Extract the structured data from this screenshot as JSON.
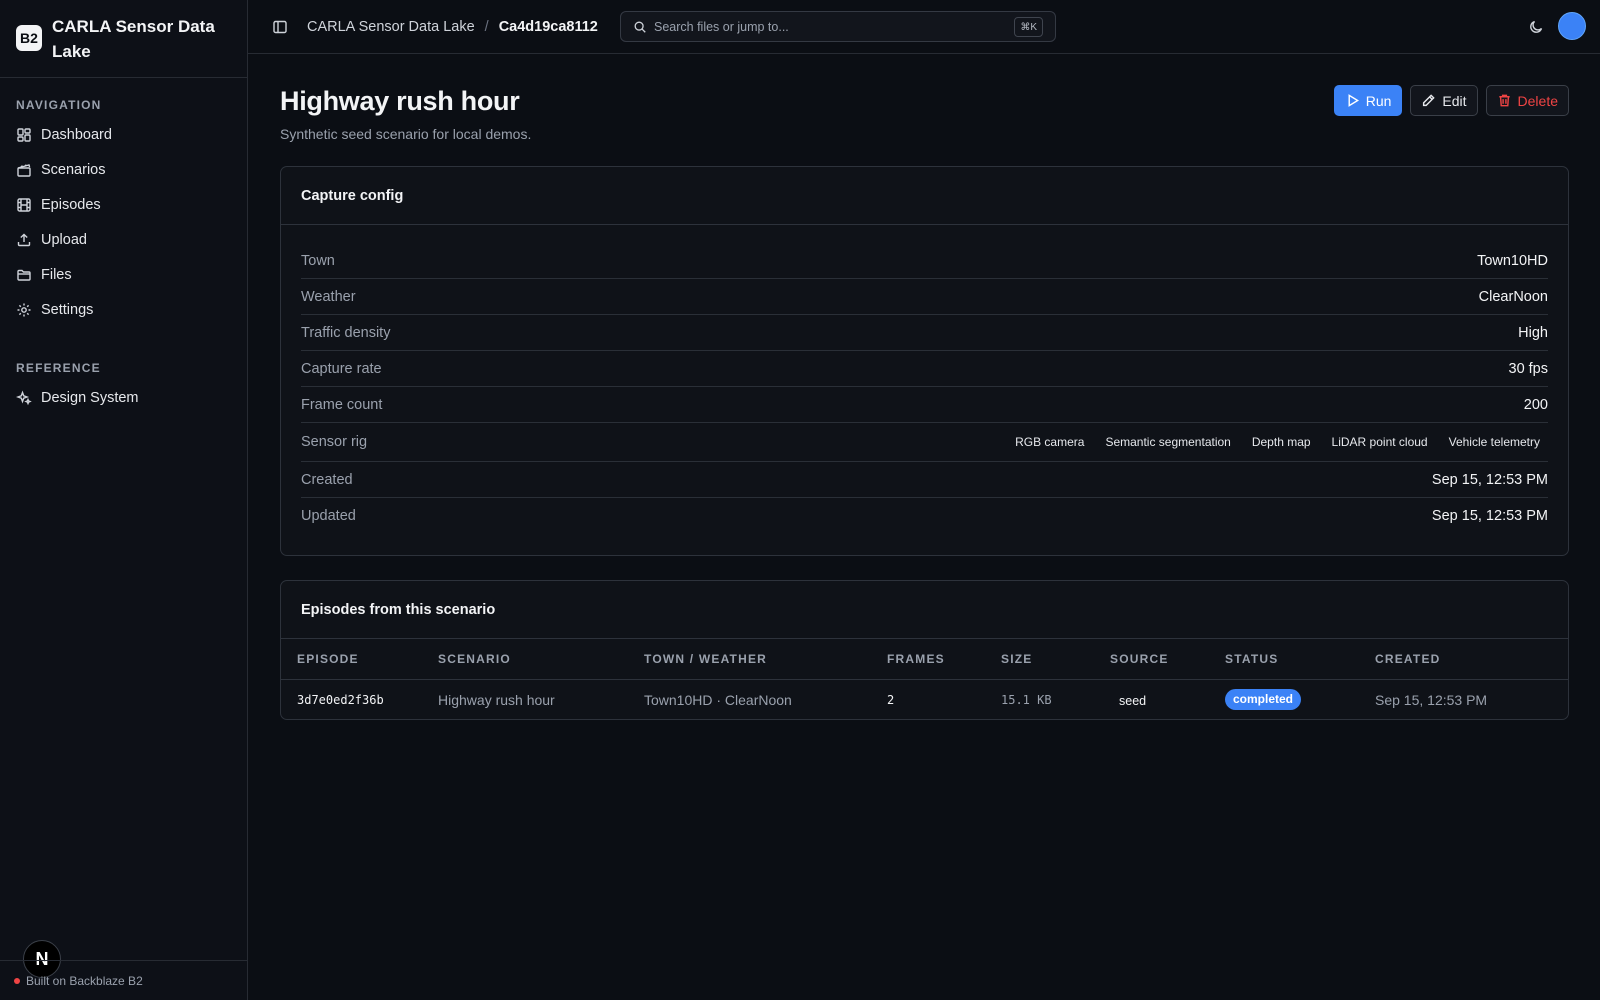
{
  "app": {
    "logo_text": "B2",
    "name": "CARLA Sensor Data Lake",
    "footer_text": "Built on Backblaze B2",
    "badge_letter": "N"
  },
  "sidebar": {
    "nav_heading": "NAVIGATION",
    "nav_items": [
      {
        "label": "Dashboard",
        "icon": "dashboard-icon"
      },
      {
        "label": "Scenarios",
        "icon": "clapperboard-icon"
      },
      {
        "label": "Episodes",
        "icon": "film-icon"
      },
      {
        "label": "Upload",
        "icon": "upload-icon"
      },
      {
        "label": "Files",
        "icon": "folder-icon"
      },
      {
        "label": "Settings",
        "icon": "gear-icon"
      }
    ],
    "reference_heading": "REFERENCE",
    "reference_items": [
      {
        "label": "Design System",
        "icon": "sparkles-icon"
      }
    ]
  },
  "topbar": {
    "breadcrumb_root": "CARLA Sensor Data Lake",
    "breadcrumb_separator": "/",
    "breadcrumb_current": "Ca4d19ca8112",
    "search_placeholder": "Search files or jump to...",
    "search_shortcut": "⌘K"
  },
  "page": {
    "title": "Highway rush hour",
    "subtitle": "Synthetic seed scenario for local demos.",
    "actions": {
      "run": "Run",
      "edit": "Edit",
      "delete": "Delete"
    }
  },
  "capture_config": {
    "title": "Capture config",
    "rows": [
      {
        "label": "Town",
        "value": "Town10HD"
      },
      {
        "label": "Weather",
        "value": "ClearNoon"
      },
      {
        "label": "Traffic density",
        "value": "High"
      },
      {
        "label": "Capture rate",
        "value": "30 fps"
      },
      {
        "label": "Frame count",
        "value": "200"
      }
    ],
    "sensor_rig": {
      "label": "Sensor rig",
      "sensors": [
        "RGB camera",
        "Semantic segmentation",
        "Depth map",
        "LiDAR point cloud",
        "Vehicle telemetry"
      ]
    },
    "timestamps": [
      {
        "label": "Created",
        "value": "Sep 15, 12:53 PM"
      },
      {
        "label": "Updated",
        "value": "Sep 15, 12:53 PM"
      }
    ]
  },
  "episodes": {
    "title": "Episodes from this scenario",
    "columns": [
      "EPISODE",
      "SCENARIO",
      "TOWN / WEATHER",
      "FRAMES",
      "SIZE",
      "SOURCE",
      "STATUS",
      "CREATED"
    ],
    "rows": [
      {
        "episode": "3d7e0ed2f36b",
        "scenario": "Highway rush hour",
        "town_weather": "Town10HD · ClearNoon",
        "frames": "2",
        "size": "15.1 KB",
        "source": "seed",
        "status": "completed",
        "created": "Sep 15, 12:53 PM"
      }
    ]
  },
  "colors": {
    "accent": "#3b82f6",
    "danger": "#ef4444",
    "background": "#0b0e14"
  }
}
